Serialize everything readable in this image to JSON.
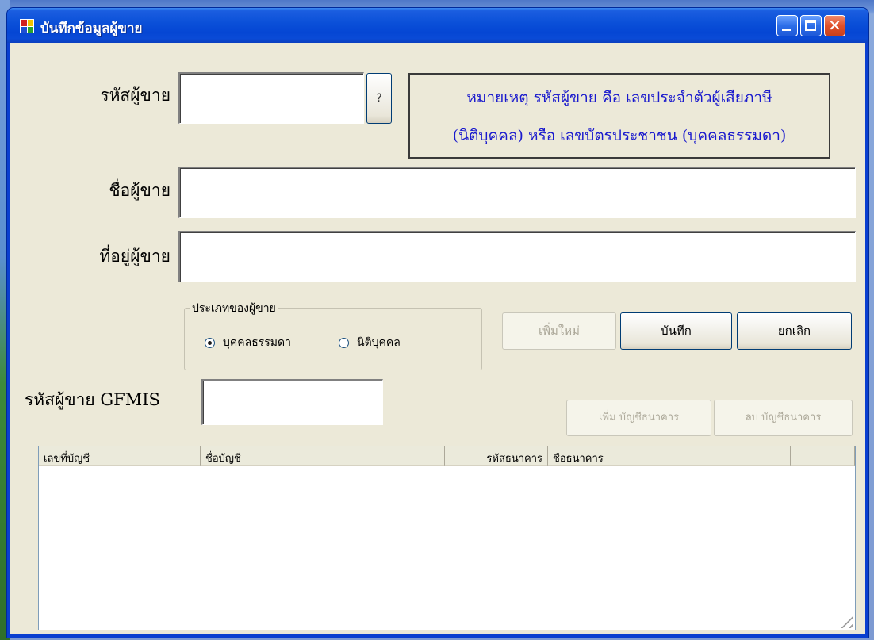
{
  "window": {
    "title": "บันทึกข้อมูลผู้ขาย"
  },
  "form": {
    "seller_code_label": "รหัสผู้ขาย",
    "seller_code_value": "",
    "lookup_button": "?",
    "note_line1": "หมายเหตุ รหัสผู้ขาย  คือ  เลขประจำตัวผู้เสียภาษี",
    "note_line2": "(นิติบุคคล) หรือ เลขบัตรประชาชน (บุคคลธรรมดา)",
    "seller_name_label": "ชื่อผู้ขาย",
    "seller_name_value": "",
    "seller_address_label": "ที่อยู่ผู้ขาย",
    "seller_address_value": "",
    "seller_type_group": "ประเภทของผู้ขาย",
    "seller_type_options": [
      "บุคคลธรรมดา",
      "นิติบุคคล"
    ],
    "seller_type_selected": "บุคคลธรรมดา",
    "new_button": "เพิ่มใหม่",
    "save_button": "บันทึก",
    "cancel_button": "ยกเลิก",
    "gfmis_label": "รหัสผู้ขาย GFMIS",
    "gfmis_value": "",
    "add_account_button": "เพิ่ม บัญชีธนาคาร",
    "delete_account_button": "ลบ บัญชีธนาคาร"
  },
  "accounts_table": {
    "columns": [
      "เลขที่บัญชี",
      "ชื่อบัญชี",
      "รหัสธนาคาร",
      "ชื่อธนาคาร",
      ""
    ],
    "rows": []
  },
  "colors": {
    "note_text": "#1a1acd",
    "titlebar": "#0a4fd8",
    "client_bg": "#ece9d8"
  }
}
